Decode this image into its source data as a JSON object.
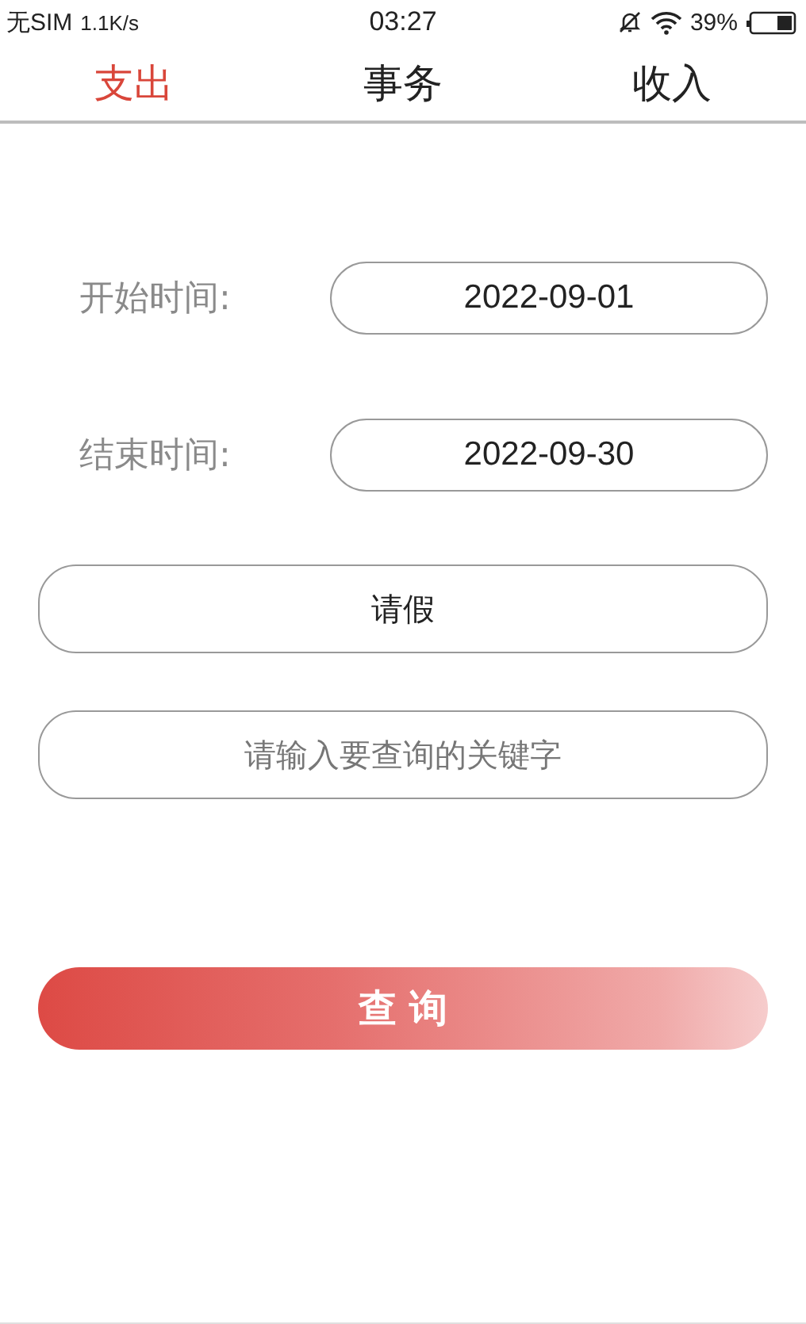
{
  "status_bar": {
    "carrier": "无SIM",
    "speed": "1.1K/s",
    "time": "03:27",
    "battery": "39%"
  },
  "tabs": [
    {
      "label": "支出",
      "selected": true
    },
    {
      "label": "事务",
      "selected": false
    },
    {
      "label": "收入",
      "selected": false
    }
  ],
  "date_fields": [
    {
      "label": "开始时间:",
      "value": "2022-09-01"
    },
    {
      "label": "结束时间:",
      "value": "2022-09-30"
    }
  ],
  "category": {
    "value": "请假"
  },
  "keyword": {
    "placeholder": "请输入要查询的关键字"
  },
  "query_button": {
    "label": "查 询"
  }
}
